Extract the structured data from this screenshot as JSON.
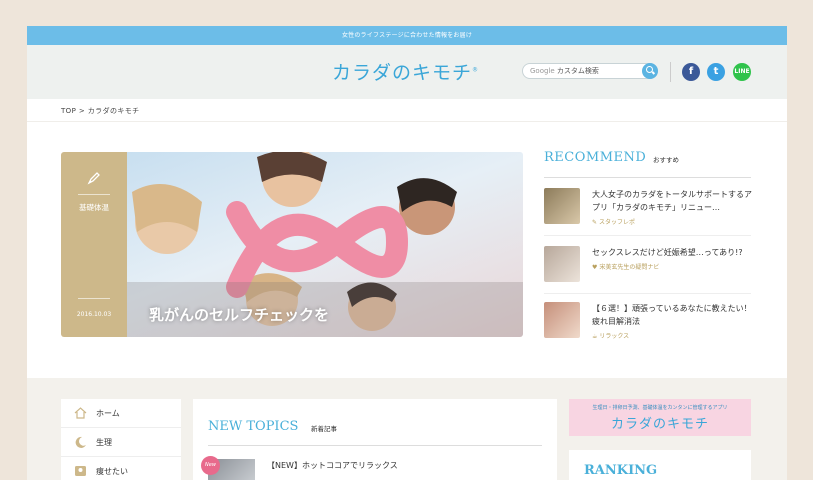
{
  "topbar": {
    "text": "女性のライフステージに合わせた情報をお届け"
  },
  "header": {
    "logo": "カラダのキモチ",
    "logo_mark": "®",
    "search": {
      "google_label": "Google",
      "placeholder": "カスタム検索"
    },
    "social": {
      "facebook": "f",
      "twitter": "t",
      "line": "LINE"
    }
  },
  "breadcrumb": {
    "home": "TOP",
    "separator": ">",
    "current": "カラダのキモチ"
  },
  "hero": {
    "category": "基礎体温",
    "date": "2016.10.03",
    "title": "乳がんのセルフチェックを"
  },
  "recommend": {
    "heading": "RECOMMEND",
    "subheading": "おすすめ",
    "items": [
      {
        "title": "大人女子のカラダをトータルサポートするアプリ「カラダのキモチ」リニュー…",
        "source": "スタッフレポ"
      },
      {
        "title": "セックスレスだけど妊娠希望…ってあり!?",
        "source": "宋美玄先生の疑問ナビ"
      },
      {
        "title": "【６選！】頑張っているあなたに教えたい！疲れ目解消法",
        "source": "リラックス"
      }
    ]
  },
  "nav": {
    "items": [
      {
        "label": "ホーム"
      },
      {
        "label": "生理"
      },
      {
        "label": "痩せたい"
      }
    ]
  },
  "topics": {
    "heading": "NEW TOPICS",
    "subheading": "新着記事",
    "badge": "New",
    "first_title": "【NEW】ホットココアでリラックス"
  },
  "banner": {
    "sub": "生理日・排卵日予測、基礎体温をカンタンに管理するアプリ",
    "logo": "カラダのキモチ"
  },
  "ranking": {
    "heading": "RANKING"
  },
  "colors": {
    "accent": "#4ab0d9",
    "topbar": "#6cbde8",
    "gold": "#cdb88a",
    "pink": "#f8d5e2"
  }
}
